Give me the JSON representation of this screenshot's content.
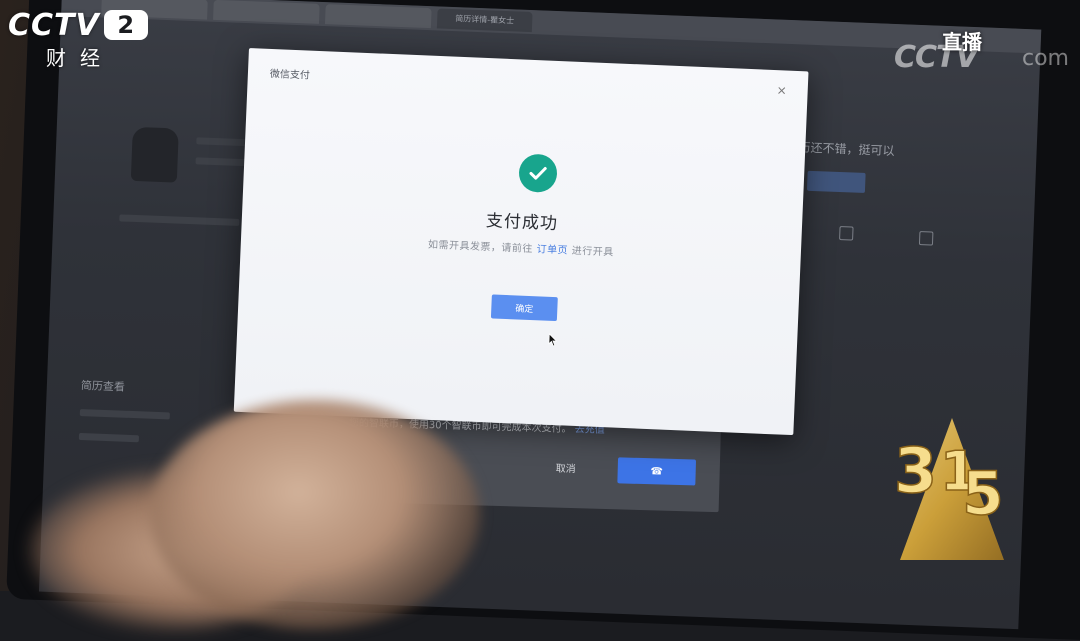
{
  "broadcast": {
    "channel_name": "CCTV",
    "channel_number": "2",
    "channel_sub": "财经",
    "live_label": "直播",
    "live_mark": "CCTV",
    "live_domain": "com",
    "event_badge": "315"
  },
  "browser": {
    "tabs": [
      "",
      "",
      "",
      "简历详情-瞿女士"
    ]
  },
  "dialog": {
    "title": "微信支付",
    "close_glyph": "×",
    "success_title": "支付成功",
    "subtitle_before": "如需开具发票，请前往",
    "subtitle_link": "订单页",
    "subtitle_after": "进行开具",
    "ok_label": "确定"
  },
  "payment_panel": {
    "note": "您的智联币，使用30个智联币即可完成本次支付。",
    "note_link": "去充值",
    "cancel_label": "取消",
    "confirm_label": "☎"
  },
  "background_page": {
    "right_text": "历还不错，挺可以",
    "section_heading": "简历查看"
  },
  "colors": {
    "success_green": "#18a58d",
    "primary_blue": "#5b8ff0",
    "link_blue": "#4a7fe0",
    "badge_gold": "#d9a93a"
  }
}
